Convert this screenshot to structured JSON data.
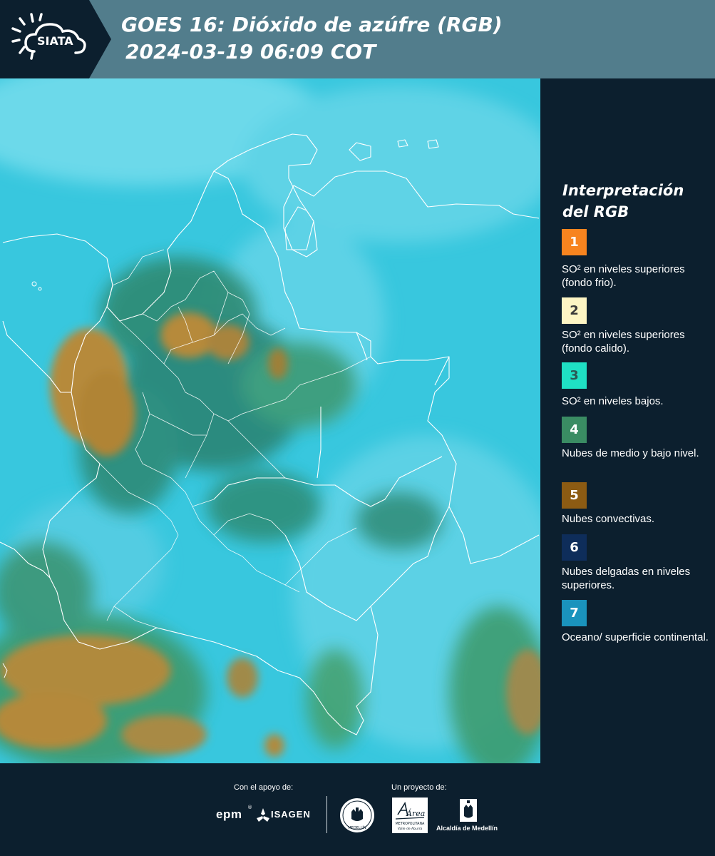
{
  "header": {
    "logo_text": "SIATA",
    "title_line1": "GOES 16: Dióxido de azúfre (RGB)",
    "title_line2": "2024-03-19 06:09 COT"
  },
  "map": {
    "icons": [
      "satellite-image",
      "country-borders",
      "department-borders"
    ]
  },
  "legend": {
    "title": "Interpretación del RGB",
    "items": [
      {
        "number": "1",
        "label": "SO² en niveles superiores (fondo frio).",
        "color": "#f7841f",
        "text_color": "#ffffff"
      },
      {
        "number": "2",
        "label": "SO² en niveles superiores (fondo calido).",
        "color": "#fdf5c4",
        "text_color": "#3a3a3a"
      },
      {
        "number": "3",
        "label": "SO² en niveles bajos.",
        "color": "#1fe0c4",
        "text_color": "#2b5a55"
      },
      {
        "number": "4",
        "label": "Nubes de medio y bajo nivel.",
        "color": "#3a8c63",
        "text_color": "#ffffff"
      },
      {
        "number": "5",
        "label": "Nubes convectivas.",
        "color": "#8c5b13",
        "text_color": "#ffffff"
      },
      {
        "number": "6",
        "label": "Nubes delgadas en niveles superiores.",
        "color": "#0e2d5a",
        "text_color": "#ffffff"
      },
      {
        "number": "7",
        "label": "Oceano/ superficie continental.",
        "color": "#1a93bd",
        "text_color": "#ffffff"
      }
    ]
  },
  "footer": {
    "support_caption": "Con el apoyo de:",
    "project_caption": "Un proyecto de:",
    "sponsor_epm": "epm",
    "sponsor_isagen": "ISAGEN",
    "area_text": "Área",
    "area_sub1": "METROPOLITANA",
    "area_sub2": "Valle de Aburrá",
    "alcaldia_text": "Alcaldía de Medellín",
    "medellin_seal_text": "MEDELLÍN"
  }
}
